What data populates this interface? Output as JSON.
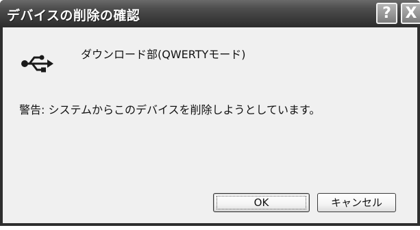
{
  "window": {
    "title": "デバイスの削除の確認",
    "help_label": "?",
    "close_label": "X"
  },
  "content": {
    "device_icon": "usb-icon",
    "device_name": "ダウンロード部(QWERTYモード)",
    "warning": "警告: システムからこのデバイスを削除しようとしています。"
  },
  "buttons": {
    "ok_label": "OK",
    "cancel_label": "キャンセル"
  },
  "colors": {
    "titlebar": "#3a3a3a",
    "client_background": "#f0f0f0"
  }
}
